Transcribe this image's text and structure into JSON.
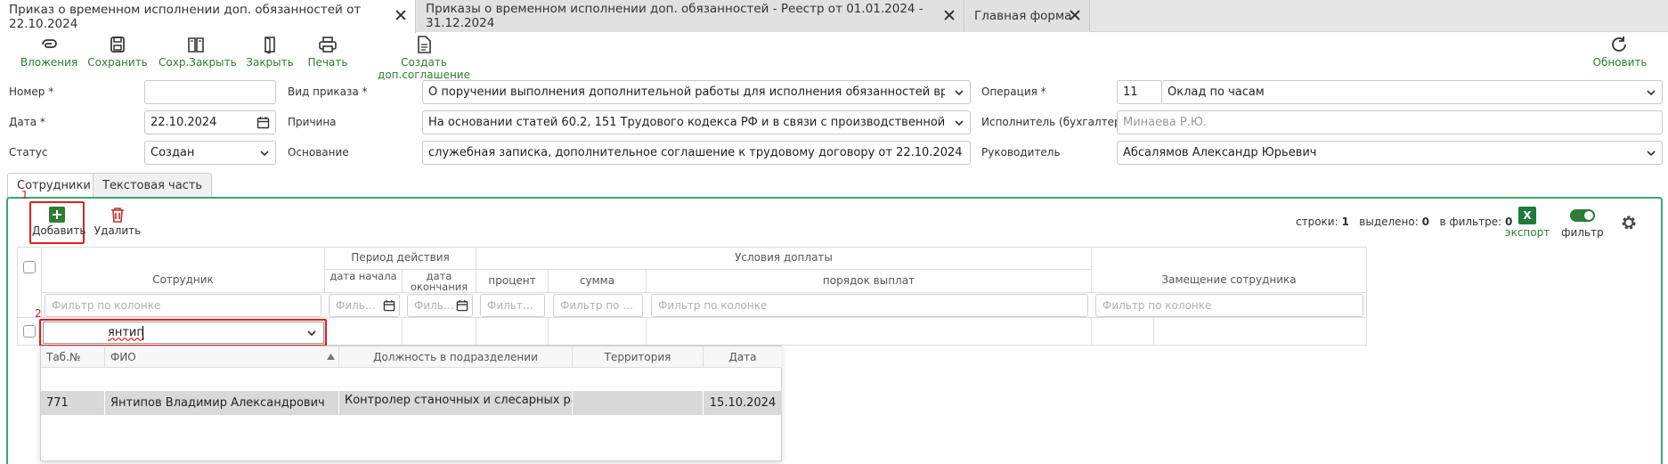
{
  "tabs": [
    {
      "label": "Приказ о временном исполнении доп. обязанностей от 22.10.2024",
      "active": true
    },
    {
      "label": "Приказы о временном исполнении доп. обязанностей - Реестр от 01.01.2024 - 31.12.2024",
      "active": false
    },
    {
      "label": "Главная форма",
      "active": false
    }
  ],
  "toolbar": {
    "attachments": "Вложения",
    "save": "Сохранить",
    "save_close": "Сохр.Закрыть",
    "close": "Закрыть",
    "print": "Печать",
    "create_agreement": "Создать доп.соглашение",
    "refresh": "Обновить"
  },
  "form": {
    "number_label": "Номер *",
    "number_value": "",
    "date_label": "Дата *",
    "date_value": "22.10.2024",
    "status_label": "Статус",
    "status_value": "Создан",
    "order_type_label": "Вид приказа *",
    "order_type_value": "О поручении выполнения дополнительной работы  для исполнения обязанностей времен",
    "reason_label": "Причина",
    "reason_value": "На основании статей 60.2, 151 Трудового кодекса РФ и в связи с производственной необходимостью",
    "basis_label": "Основание",
    "basis_value": "служебная записка, дополнительное соглашение к трудовому договору от 22.10.2024",
    "operation_label": "Операция *",
    "operation_code": "11",
    "operation_value": "Оклад по часам",
    "executor_label": "Исполнитель (бухгалтер)",
    "executor_value": "Минаева Р.Ю.",
    "manager_label": "Руководитель",
    "manager_value": "Абсалямов Александр Юрьевич"
  },
  "subtabs": {
    "employees": "Сотрудники",
    "text_part": "Текстовая часть"
  },
  "markers": {
    "first": "1",
    "second": "2"
  },
  "grid_toolbar": {
    "add": "Добавить",
    "delete": "Удалить",
    "rows_label": "строки:",
    "rows_value": "1",
    "selected_label": "выделено:",
    "selected_value": "0",
    "filtered_label": "в фильтре:",
    "filtered_value": "0",
    "export": "экспорт",
    "export_icon_text": "X",
    "filter": "фильтр"
  },
  "grid": {
    "employee_header": "Сотрудник",
    "period_header": "Период действия",
    "start_date_header": "дата начала",
    "end_date_header": "дата окончания",
    "conditions_header": "Условия доплаты",
    "percent_header": "процент",
    "sum_header": "сумма",
    "payment_order_header": "порядок выплат",
    "substitution_header": "Замещение сотрудника",
    "filter_placeholder": "Фильтр по колонке",
    "filter_short_1": "Филь…",
    "filter_short_2": "Филь…",
    "filter_short_3": "Фильт…",
    "filter_short_4": "Фильтр по …",
    "search_value": "янтип"
  },
  "dropdown": {
    "headers": {
      "tab_no": "Таб.№",
      "fio": "ФИО",
      "position": "Должность в подразделении",
      "territory": "Территория",
      "date": "Дата"
    },
    "row": {
      "tab_no": "771",
      "fio": "Янтипов Владимир Александрович",
      "position": "Контролер станочных и слесарных ра…",
      "territory": "",
      "date": "15.10.2024"
    }
  }
}
